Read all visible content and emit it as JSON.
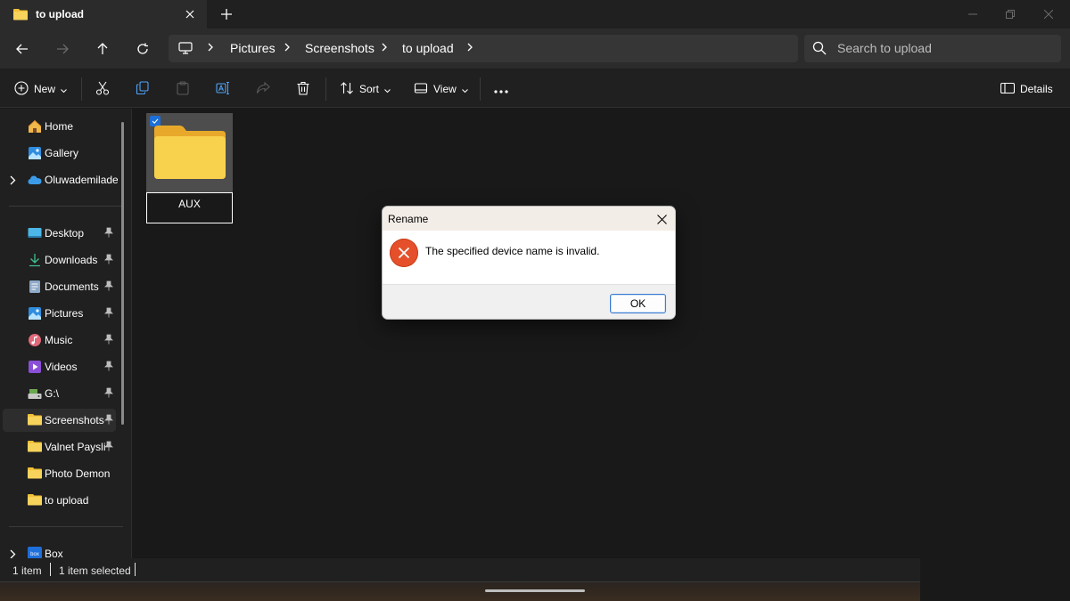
{
  "tab": {
    "title": "to upload"
  },
  "address": {
    "crumbs": [
      "Pictures",
      "Screenshots",
      "to upload"
    ]
  },
  "search": {
    "placeholder": "Search to upload"
  },
  "commands": {
    "new_label": "New",
    "sort_label": "Sort",
    "view_label": "View",
    "details_label": "Details"
  },
  "sidebar": {
    "items": [
      {
        "label": "Home",
        "icon": "home-icon"
      },
      {
        "label": "Gallery",
        "icon": "gallery-icon"
      },
      {
        "label": "Oluwademilade",
        "icon": "onedrive-cloud-icon"
      },
      {
        "label": "Desktop",
        "icon": "desktop-icon"
      },
      {
        "label": "Downloads",
        "icon": "downloads-icon"
      },
      {
        "label": "Documents",
        "icon": "documents-icon"
      },
      {
        "label": "Pictures",
        "icon": "pictures-icon"
      },
      {
        "label": "Music",
        "icon": "music-icon"
      },
      {
        "label": "Videos",
        "icon": "videos-icon"
      },
      {
        "label": "G:\\",
        "icon": "drive-icon"
      },
      {
        "label": "Screenshots",
        "icon": "folder-icon"
      },
      {
        "label": "Valnet Payslips",
        "icon": "folder-icon"
      },
      {
        "label": "Photo Demon",
        "icon": "folder-icon"
      },
      {
        "label": "to upload",
        "icon": "folder-icon"
      },
      {
        "label": "Box",
        "icon": "box-icon"
      }
    ],
    "selected": "Screenshots"
  },
  "content": {
    "folder_name": "AUX"
  },
  "status": {
    "item_count": "1 item",
    "selection": "1 item selected"
  },
  "dialog": {
    "title": "Rename",
    "message": "The specified device name is invalid.",
    "ok_label": "OK"
  },
  "colors": {
    "accent": "#1c6fd6",
    "error": "#e5502a",
    "folder": "#f7c948"
  }
}
